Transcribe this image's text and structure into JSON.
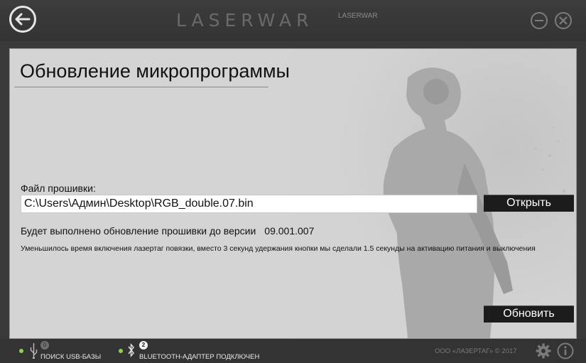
{
  "header": {
    "logo": "LASERWAR",
    "logo_small": "LASERWAR"
  },
  "main": {
    "title": "Обновление микропрограммы",
    "file_label": "Файл прошивки:",
    "file_path": "C:\\Users\\Админ\\Desktop\\RGB_double.07.bin",
    "open_button": "Открыть",
    "version_text": "Будет выполнено обновление прошивки до версии",
    "version_number": "09.001.007",
    "description": "Уменьшилось время включения лазертаг повязки, вместо 3 секунд удержания кнопки мы сделали 1.5 секунды на активацию питания и выключения",
    "update_button": "Обновить"
  },
  "footer": {
    "usb_count": "0",
    "usb_text": "ПОИСК USB-БАЗЫ",
    "bt_count": "2",
    "bt_text": "BLUETOOTH-АДАПТЕР ПОДКЛЮЧЕН",
    "copyright": "ООО «ЛАЗЕРТАГ» © 2017"
  },
  "colors": {
    "status_green": "#8fd14f",
    "button_dark": "#1c1c1c",
    "chrome": "#333333"
  },
  "icons": [
    "back-arrow-icon",
    "minimize-icon",
    "close-icon",
    "usb-icon",
    "bluetooth-icon",
    "gear-icon",
    "info-icon"
  ]
}
